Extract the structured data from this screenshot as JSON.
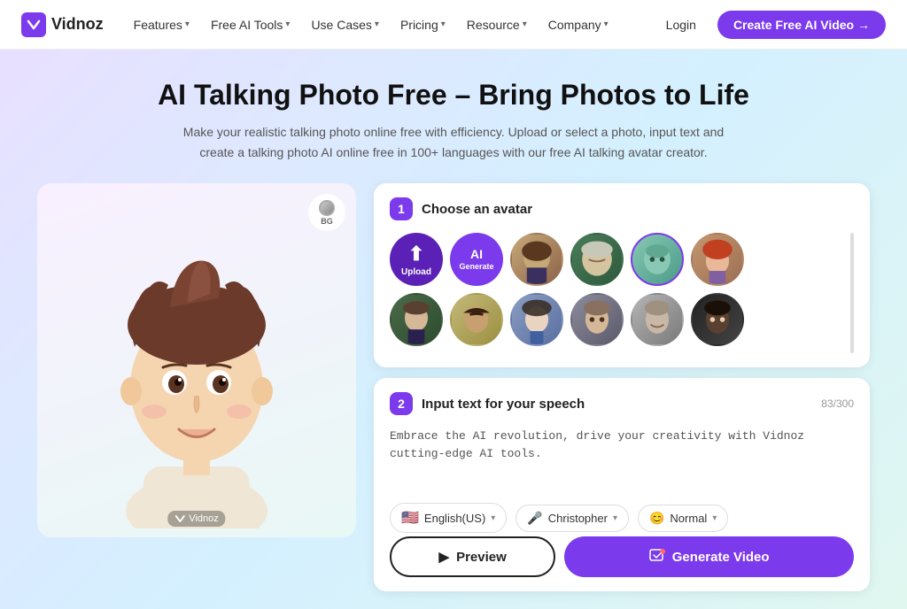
{
  "logo": {
    "text": "Vidnoz",
    "icon": "V"
  },
  "nav": {
    "items": [
      {
        "label": "Features",
        "hasDropdown": true
      },
      {
        "label": "Free AI Tools",
        "hasDropdown": true
      },
      {
        "label": "Use Cases",
        "hasDropdown": true
      },
      {
        "label": "Pricing",
        "hasDropdown": true
      },
      {
        "label": "Resource",
        "hasDropdown": true
      },
      {
        "label": "Company",
        "hasDropdown": true
      }
    ],
    "login_label": "Login",
    "create_label": "Create Free AI Video →"
  },
  "hero": {
    "title": "AI Talking Photo Free – Bring Photos to Life",
    "subtitle": "Make your realistic talking photo online free with efficiency. Upload or select a photo, input text and create a talking photo AI online free in 100+ languages with our free AI talking avatar creator."
  },
  "avatar_section": {
    "step_number": "1",
    "step_title": "Choose an avatar",
    "upload_label": "Upload",
    "generate_label": "AI\nGenerate",
    "bg_button_label": "BG",
    "watermark": "Vidnoz"
  },
  "speech_section": {
    "step_number": "2",
    "step_title": "Input text for your speech",
    "char_count": "83/300",
    "speech_text": "Embrace the AI revolution, drive your creativity with Vidnoz cutting-edge AI tools."
  },
  "controls": {
    "language": {
      "flag": "🇺🇸",
      "label": "English(US)",
      "has_dropdown": true
    },
    "voice": {
      "icon": "🎤",
      "label": "Christopher",
      "has_dropdown": true
    },
    "tone": {
      "icon": "😊",
      "label": "Normal",
      "has_dropdown": true
    }
  },
  "actions": {
    "preview_label": "▶ Preview",
    "generate_label": "Generate Video"
  }
}
